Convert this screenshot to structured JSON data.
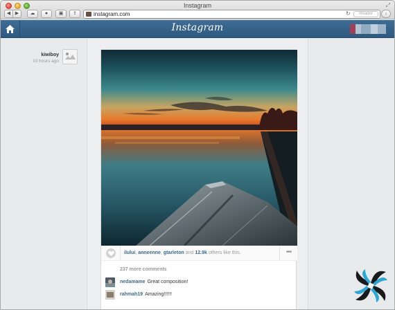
{
  "window": {
    "title": "Instagram"
  },
  "toolbar": {
    "url": "instagram.com",
    "reader_label": "Reader"
  },
  "header": {
    "logo": "Instagram"
  },
  "post": {
    "username": "kiwiboy",
    "time_ago": "10 hours ago",
    "likers": [
      "ilului",
      "anneenne",
      "gtarleton"
    ],
    "likes_and": "and",
    "likes_count": "12.9k",
    "likes_suffix": "others like this.",
    "more_comments": "237 more comments",
    "comments": [
      {
        "author": "nedamame",
        "text": "Great composition!"
      },
      {
        "author": "rahmah19",
        "text": "Amazing!!!!!!"
      }
    ]
  },
  "colors": {
    "header_blue": "#345f87",
    "link_blue": "#3a6a93"
  }
}
